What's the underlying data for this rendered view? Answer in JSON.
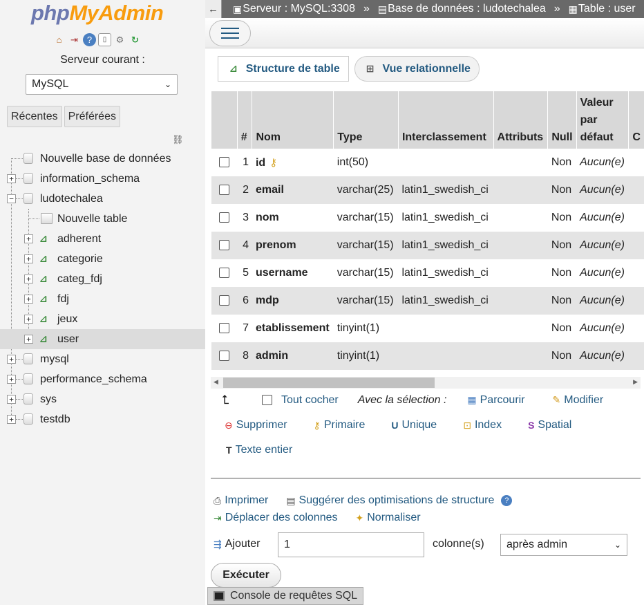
{
  "sidebar": {
    "logo_php": "php",
    "logo_admin": "MyAdmin",
    "server_label": "Serveur courant :",
    "server_select": "MySQL",
    "tabs": [
      "Récentes",
      "Préférées"
    ],
    "tree": [
      {
        "label": "Nouvelle base de données",
        "level": 0,
        "kind": "newdb"
      },
      {
        "label": "information_schema",
        "level": 0,
        "kind": "db"
      },
      {
        "label": "ludotechalea",
        "level": 0,
        "kind": "db-open"
      },
      {
        "label": "Nouvelle table",
        "level": 1,
        "kind": "newtable"
      },
      {
        "label": "adherent",
        "level": 1,
        "kind": "table"
      },
      {
        "label": "categorie",
        "level": 1,
        "kind": "table"
      },
      {
        "label": "categ_fdj",
        "level": 1,
        "kind": "table"
      },
      {
        "label": "fdj",
        "level": 1,
        "kind": "table"
      },
      {
        "label": "jeux",
        "level": 1,
        "kind": "table"
      },
      {
        "label": "user",
        "level": 1,
        "kind": "table-selected"
      },
      {
        "label": "mysql",
        "level": 0,
        "kind": "db"
      },
      {
        "label": "performance_schema",
        "level": 0,
        "kind": "db"
      },
      {
        "label": "sys",
        "level": 0,
        "kind": "db"
      },
      {
        "label": "testdb",
        "level": 0,
        "kind": "db"
      }
    ]
  },
  "breadcrumb": {
    "back": "←",
    "server": "Serveur : MySQL:3308",
    "sep": "»",
    "database": "Base de données : ludotechalea",
    "table": "Table : user"
  },
  "subtabs": {
    "structure": "Structure de table",
    "relational": "Vue relationnelle"
  },
  "table": {
    "headers": [
      "",
      "#",
      "Nom",
      "Type",
      "Interclassement",
      "Attributs",
      "Null",
      "Valeur par défaut",
      "C"
    ],
    "rows": [
      {
        "num": "1",
        "name": "id",
        "type": "int(50)",
        "collation": "",
        "null": "Non",
        "default": "Aucun(e)",
        "primary": true
      },
      {
        "num": "2",
        "name": "email",
        "type": "varchar(25)",
        "collation": "latin1_swedish_ci",
        "null": "Non",
        "default": "Aucun(e)"
      },
      {
        "num": "3",
        "name": "nom",
        "type": "varchar(15)",
        "collation": "latin1_swedish_ci",
        "null": "Non",
        "default": "Aucun(e)"
      },
      {
        "num": "4",
        "name": "prenom",
        "type": "varchar(15)",
        "collation": "latin1_swedish_ci",
        "null": "Non",
        "default": "Aucun(e)"
      },
      {
        "num": "5",
        "name": "username",
        "type": "varchar(15)",
        "collation": "latin1_swedish_ci",
        "null": "Non",
        "default": "Aucun(e)"
      },
      {
        "num": "6",
        "name": "mdp",
        "type": "varchar(15)",
        "collation": "latin1_swedish_ci",
        "null": "Non",
        "default": "Aucun(e)"
      },
      {
        "num": "7",
        "name": "etablissement",
        "type": "tinyint(1)",
        "collation": "",
        "null": "Non",
        "default": "Aucun(e)"
      },
      {
        "num": "8",
        "name": "admin",
        "type": "tinyint(1)",
        "collation": "",
        "null": "Non",
        "default": "Aucun(e)"
      }
    ]
  },
  "selection": {
    "check_all": "Tout cocher",
    "with_selection": "Avec la sélection :",
    "browse": "Parcourir",
    "modify": "Modifier",
    "delete": "Supprimer",
    "primary": "Primaire",
    "unique": "Unique",
    "index": "Index",
    "spatial": "Spatial",
    "fulltext": "Texte entier"
  },
  "footer": {
    "print": "Imprimer",
    "suggest": "Suggérer des optimisations de structure",
    "move_columns": "Déplacer des colonnes",
    "normalize": "Normaliser",
    "add_label": "Ajouter",
    "add_value": "1",
    "columns_label": "colonne(s)",
    "position_select": "après admin",
    "execute": "Exécuter",
    "console": "Console de requêtes SQL"
  }
}
